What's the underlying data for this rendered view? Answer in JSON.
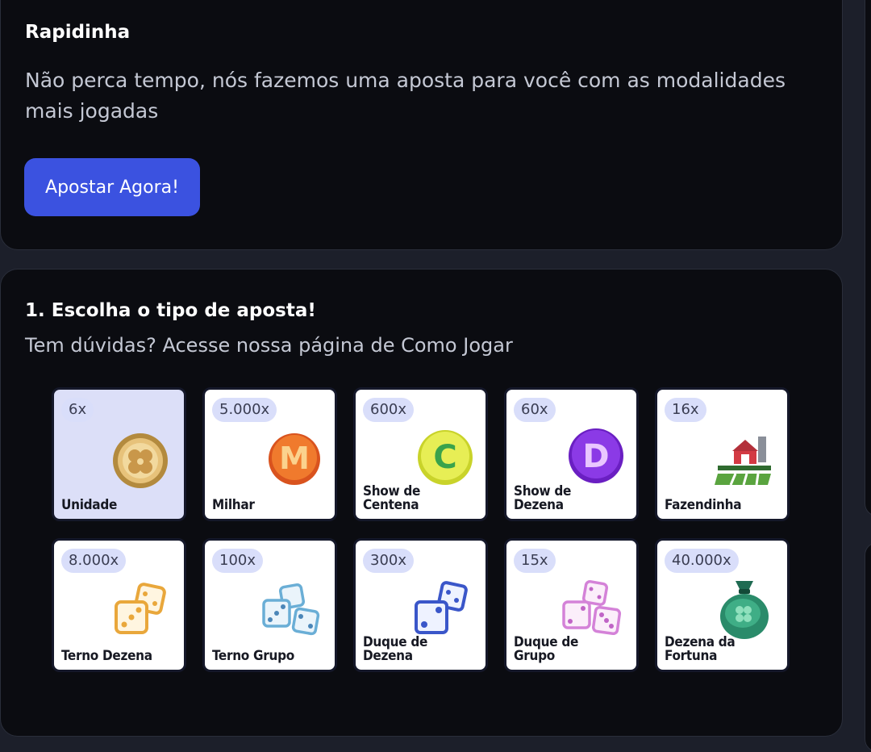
{
  "quick": {
    "title": "Rapidinha",
    "description_line1": "Não perca tempo, nós fazemos uma aposta para você com as modalidades",
    "description_line2": "mais jogadas",
    "button_label": "Apostar Agora!"
  },
  "bet": {
    "title": "1. Escolha o tipo de aposta!",
    "help": "Tem dúvidas? Acesse nossa página de Como Jogar",
    "tiles": [
      {
        "multiplier": "6x",
        "label_1": "Unidade",
        "label_2": "",
        "icon": "clover-coin-icon",
        "selected": true
      },
      {
        "multiplier": "5.000x",
        "label_1": "Milhar",
        "label_2": "",
        "icon": "letter-m-coin-icon"
      },
      {
        "multiplier": "600x",
        "label_1": "Show de",
        "label_2": "Centena",
        "icon": "letter-c-coin-icon"
      },
      {
        "multiplier": "60x",
        "label_1": "Show de",
        "label_2": "Dezena",
        "icon": "letter-d-coin-icon"
      },
      {
        "multiplier": "16x",
        "label_1": "Fazendinha",
        "label_2": "",
        "icon": "farm-icon"
      },
      {
        "multiplier": "8.000x",
        "label_1": "Terno Dezena",
        "label_2": "",
        "icon": "dice-orange-icon"
      },
      {
        "multiplier": "100x",
        "label_1": "Terno Grupo",
        "label_2": "",
        "icon": "dice-blue-icon"
      },
      {
        "multiplier": "300x",
        "label_1": "Duque de",
        "label_2": "Dezena",
        "icon": "dice-navy-icon"
      },
      {
        "multiplier": "15x",
        "label_1": "Duque de",
        "label_2": "Grupo",
        "icon": "dice-pink-icon"
      },
      {
        "multiplier": "40.000x",
        "label_1": "Dezena da",
        "label_2": "Fortuna",
        "icon": "money-bag-icon"
      }
    ]
  },
  "colors": {
    "accent": "#3b52e0",
    "card_bg": "#0b0c11",
    "page_bg": "#1c1f2a",
    "badge_bg": "#d9defa",
    "selected_tile_bg": "#dcdff8"
  }
}
